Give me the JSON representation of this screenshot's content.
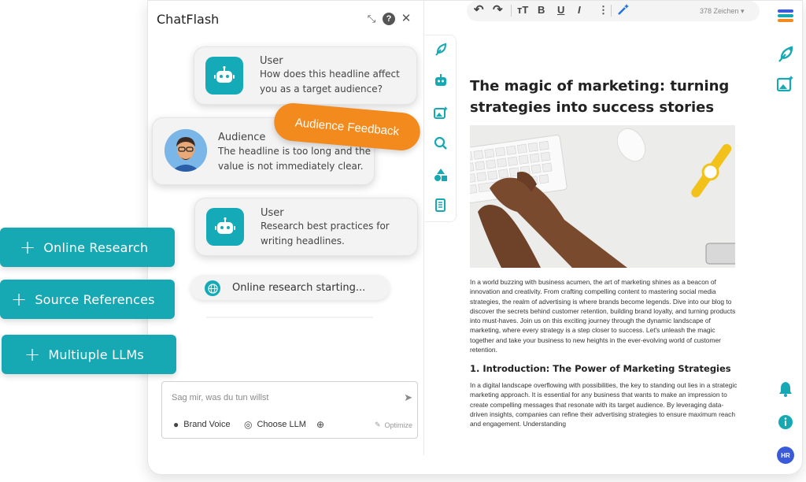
{
  "chat": {
    "title": "ChatFlash",
    "messages": [
      {
        "name": "User",
        "text_line1": "How does this headline affect",
        "text_line2": "you as a target audience?"
      },
      {
        "name": "Audience",
        "text_line1": "The headline is too long and the",
        "text_line2": "value is not immediately clear."
      },
      {
        "name": "User",
        "text_line1": "Research best practices for",
        "text_line2": "writing headlines."
      }
    ],
    "tag": "Audience Feedback",
    "research_status": "Online research starting...",
    "input": {
      "placeholder": "Sag mir, was du tun willst",
      "brand_voice": "Brand Voice",
      "choose_llm": "Choose LLM",
      "optimize": "Optimize"
    }
  },
  "features": [
    {
      "label": "Online Research"
    },
    {
      "label": "Source References"
    },
    {
      "label": "Multiuple LLMs"
    }
  ],
  "toolbar": {
    "bold": "B",
    "underline": "U",
    "italic": "I",
    "char_count": "378 Zeichen"
  },
  "document": {
    "title": "The magic of marketing: turning strategies into success stories",
    "intro": "In a world buzzing with business acumen, the art of marketing shines as a beacon of innovation and creativity. From crafting compelling content to mastering social media strategies, the realm of advertising is where brands become legends. Dive into our blog to discover the secrets behind customer retention, building brand loyalty, and turning products into must-haves. Join us on this exciting journey through the dynamic landscape of marketing, where every strategy is a step closer to success. Let's unleash the magic together and take your business to new heights in the ever-evolving world of customer retention.",
    "section_heading": "1. Introduction: The Power of Marketing Strategies",
    "section_body": "In a digital landscape overflowing with possibilities, the key to standing out lies in a strategic marketing approach. It is essential for any business that wants to make an impression to create compelling messages that resonate with its target audience. By leveraging data-driven insights, companies can refine their advertising strategies to ensure maximum reach and engagement. Understanding"
  },
  "user": {
    "initials": "HR"
  },
  "colors": {
    "teal": "#16a9b4",
    "orange": "#f28a1d",
    "avatar_blue": "#3a5bd9"
  }
}
